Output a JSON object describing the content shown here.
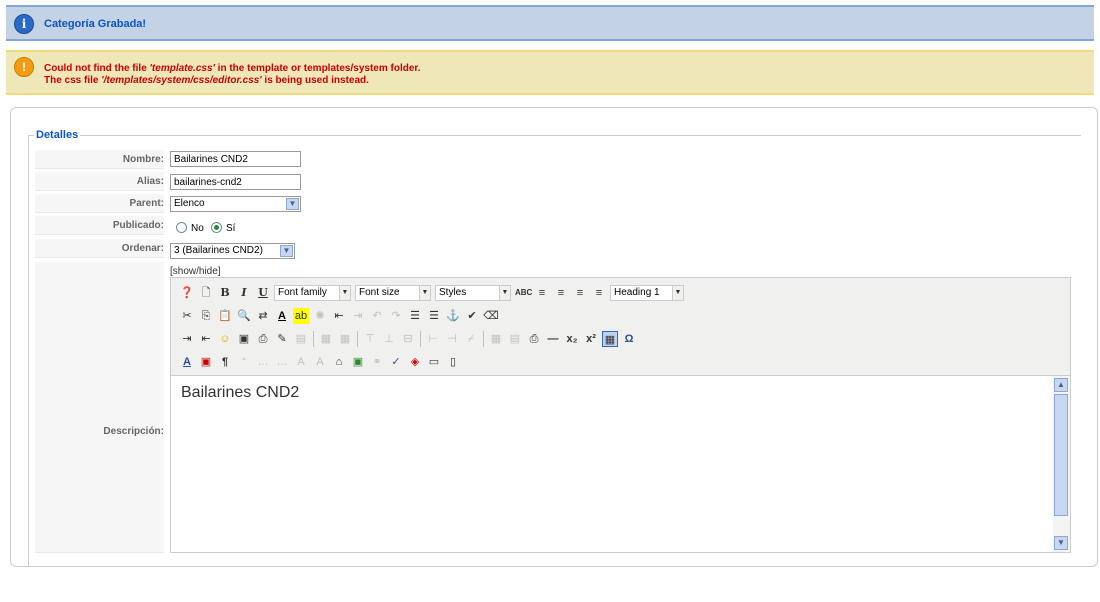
{
  "messages": {
    "info": "Categoría Grabada!",
    "warning_line1_pre": "Could not find the file ",
    "warning_line1_file": "'template.css'",
    "warning_line1_post": " in the template or templates/system folder.",
    "warning_line2_pre": "The css file ",
    "warning_line2_file": "'/templates/system/css/editor.css'",
    "warning_line2_post": " is being used instead."
  },
  "form": {
    "legend": "Detalles",
    "nombre_label": "Nombre:",
    "nombre_value": "Bailarines CND2",
    "alias_label": "Alias:",
    "alias_value": "bailarines-cnd2",
    "parent_label": "Parent:",
    "parent_value": "Elenco",
    "publicado_label": "Publicado:",
    "publicado_no": "No",
    "publicado_si": "Sí",
    "publicado_selected": "Sí",
    "ordenar_label": "Ordenar:",
    "ordenar_value": "3 (Bailarines CND2)",
    "showhide": "[show/hide]",
    "descripcion_label": "Descripción:"
  },
  "editor": {
    "font_family": "Font family",
    "font_size": "Font size",
    "styles": "Styles",
    "format": "Heading 1",
    "content": "Bailarines CND2"
  }
}
